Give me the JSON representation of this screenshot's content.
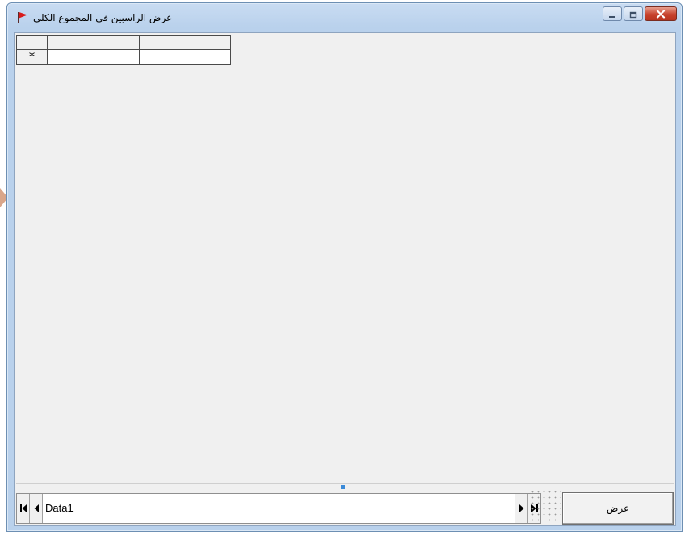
{
  "window": {
    "title": "عرض الراسبين في المجموع الكلي",
    "icon": "red-flag-icon",
    "controls": [
      "minimize-icon",
      "maximize-icon",
      "close-icon"
    ]
  },
  "grid": {
    "new_row_marker": "*",
    "columns": [
      "",
      ""
    ],
    "rows": [
      [
        "",
        ""
      ]
    ]
  },
  "nav": {
    "first": "first-record-icon",
    "prev": "previous-record-icon",
    "caption": "Data1",
    "next": "next-record-icon",
    "last": "last-record-icon"
  },
  "actions": {
    "show_label": "عرض"
  },
  "colors": {
    "flag": "#d81b1b",
    "close_button": "#c7422c",
    "accent": "#3b8ad8"
  }
}
